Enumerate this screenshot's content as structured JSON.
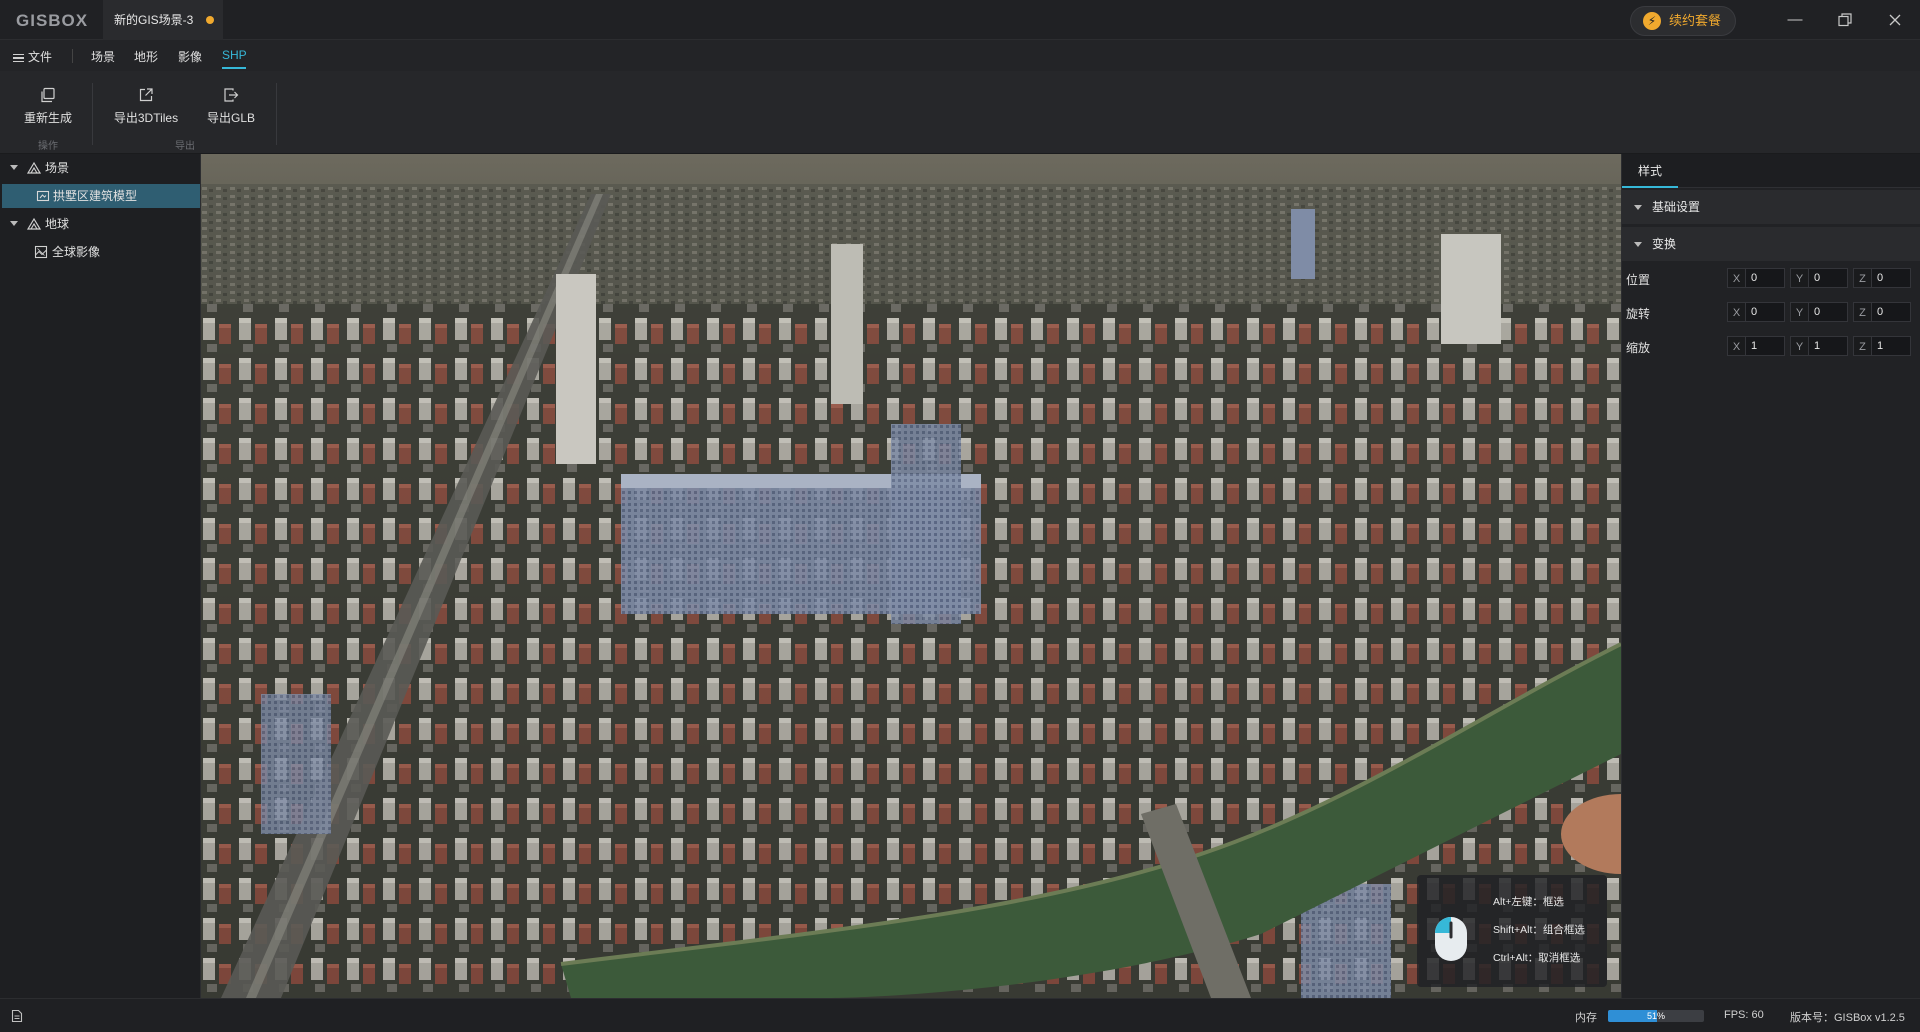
{
  "app": {
    "logo": "GISBOX",
    "doc_tab": "新的GIS场景-3",
    "renew_label": "续约套餐"
  },
  "menu": {
    "file": "文件",
    "items": [
      "场景",
      "地形",
      "影像",
      "SHP"
    ],
    "active": "SHP"
  },
  "ribbon": {
    "buttons": [
      {
        "label": "重新生成",
        "icon": "regenerate-icon"
      },
      {
        "label": "导出3DTiles",
        "icon": "export-icon"
      },
      {
        "label": "导出GLB",
        "icon": "export-glb-icon"
      }
    ],
    "groups": [
      "操作",
      "导出"
    ]
  },
  "tree": [
    {
      "label": "场景",
      "icon": "scene-icon",
      "level": 0
    },
    {
      "label": "拱墅区建筑模型",
      "icon": "model-icon",
      "level": 1,
      "selected": true
    },
    {
      "label": "地球",
      "icon": "globe-icon",
      "level": 0
    },
    {
      "label": "全球影像",
      "icon": "imagery-icon",
      "level": 1
    }
  ],
  "viewport": {
    "hints": [
      "Alt+左键：框选",
      "Shift+Alt：组合框选",
      "Ctrl+Alt：取消框选"
    ]
  },
  "rightpanel": {
    "tab": "样式",
    "sections": [
      "基础设置",
      "变换"
    ],
    "props": [
      {
        "label": "位置",
        "x": "0",
        "y": "0",
        "z": "0"
      },
      {
        "label": "旋转",
        "x": "0",
        "y": "0",
        "z": "0"
      },
      {
        "label": "缩放",
        "x": "1",
        "y": "1",
        "z": "1"
      }
    ],
    "axes": [
      "X",
      "Y",
      "Z"
    ]
  },
  "status": {
    "memory_label": "内存",
    "memory_percent": 51,
    "memory_text": "51%",
    "fps": "FPS: 60",
    "version": "版本号：GISBox v1.2.5"
  },
  "colors": {
    "accent": "#36b8d8",
    "warning": "#f0a92e",
    "selection": "#2f5e72"
  }
}
